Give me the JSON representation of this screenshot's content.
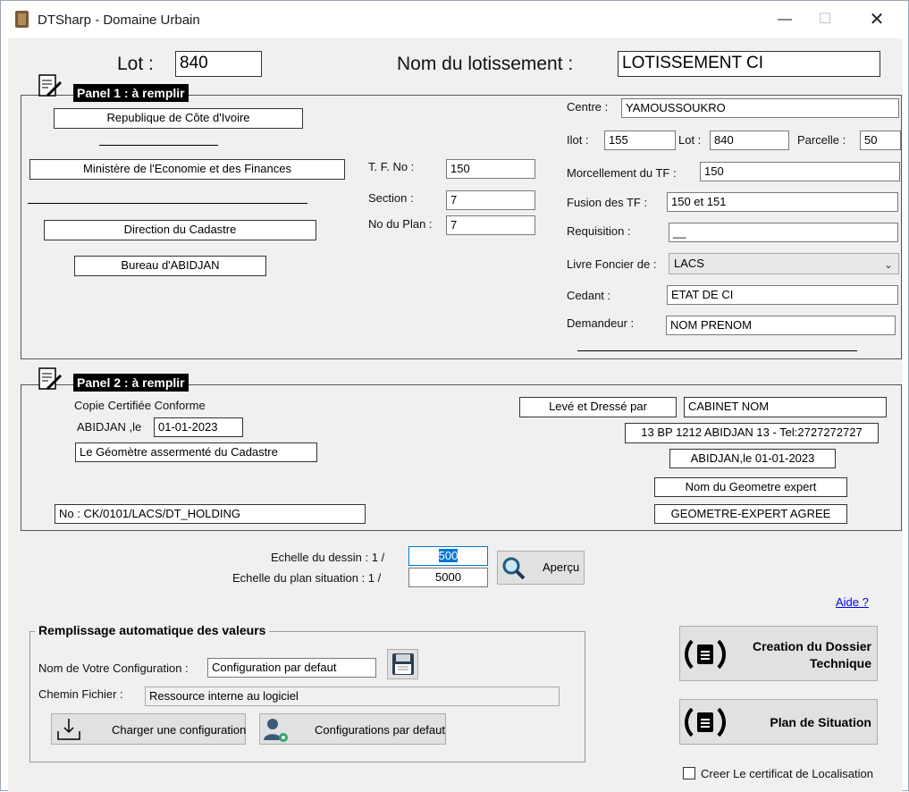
{
  "window": {
    "title": "DTSharp - Domaine Urbain"
  },
  "header": {
    "lot_label": "Lot :",
    "lot_value": "840",
    "lotissement_label": "Nom du lotissement :",
    "lotissement_value": "LOTISSEMENT CI"
  },
  "panel1": {
    "title": "Panel 1 : à remplir",
    "republique": "Republique de Côte d'Ivoire",
    "ministere": "Ministère de l'Economie et des Finances",
    "direction": "Direction du Cadastre",
    "bureau": "Bureau d'ABIDJAN",
    "tf_label": "T. F. No :",
    "tf_value": "150",
    "section_label": "Section :",
    "section_value": "7",
    "plan_label": "No du Plan :",
    "plan_value": "7",
    "centre_label": "Centre :",
    "centre_value": "YAMOUSSOUKRO",
    "ilot_label": "Ilot :",
    "ilot_value": "155",
    "lot_label": "Lot :",
    "lot_value": "840",
    "parcelle_label": "Parcelle :",
    "parcelle_value": "50",
    "morcellement_label": "Morcellement du TF :",
    "morcellement_value": "150",
    "fusion_label": "Fusion des TF :",
    "fusion_value": "150 et 151",
    "requisition_label": "Requisition :",
    "requisition_value": "__",
    "livre_label": "Livre Foncier de :",
    "livre_value": "LACS",
    "cedant_label": "Cedant :",
    "cedant_value": "ETAT DE CI",
    "demandeur_label": "Demandeur :",
    "demandeur_value": "NOM PRENOM"
  },
  "panel2": {
    "title": "Panel 2 : à remplir",
    "copie_label": "Copie Certifiée Conforme",
    "abidjan_label": "ABIDJAN ,le",
    "date_value": "01-01-2023",
    "geometre_cadastre": "Le Géomètre assermenté du Cadastre",
    "no_value": "No : CK/0101/LACS/DT_HOLDING",
    "leve_label": "Levé et Dressé par",
    "cabinet_value": "CABINET NOM",
    "adresse_value": "13 BP 1212 ABIDJAN 13 - Tel:2727272727",
    "abidjan_date_value": "ABIDJAN,le 01-01-2023",
    "nom_geometre_value": "Nom du Geometre expert",
    "geometre_agree_value": "GEOMETRE-EXPERT AGREE"
  },
  "echelle": {
    "dessin_label": "Echelle du dessin : 1 /",
    "dessin_value": "500",
    "situation_label": "Echelle du plan situation : 1 /",
    "situation_value": "5000",
    "apercu_label": "Aperçu"
  },
  "aide_label": "Aide ?",
  "config": {
    "title": "Remplissage automatique des valeurs",
    "nom_label": "Nom de Votre Configuration :",
    "nom_value": "Configuration par defaut",
    "chemin_label": "Chemin Fichier :",
    "chemin_value": "Ressource interne au logiciel",
    "charger_label": "Charger une configuration",
    "defaut_label": "Configurations par defaut"
  },
  "actions": {
    "creation_line1": "Creation du Dossier",
    "creation_line2": "Technique",
    "plan_situation": "Plan de Situation",
    "certificat_label": "Creer Le certificat de Localisation"
  },
  "colors": {
    "panel_title_bg": "#000000",
    "link": "#0000ee",
    "selection": "#0078d7"
  },
  "icons": [
    "app-icon",
    "minimize-icon",
    "maximize-icon",
    "close-icon",
    "pen-paper-icon",
    "magnifier-icon",
    "save-disk-icon",
    "download-icon",
    "user-gear-icon",
    "document-cycle-icon",
    "chevron-down-icon"
  ]
}
